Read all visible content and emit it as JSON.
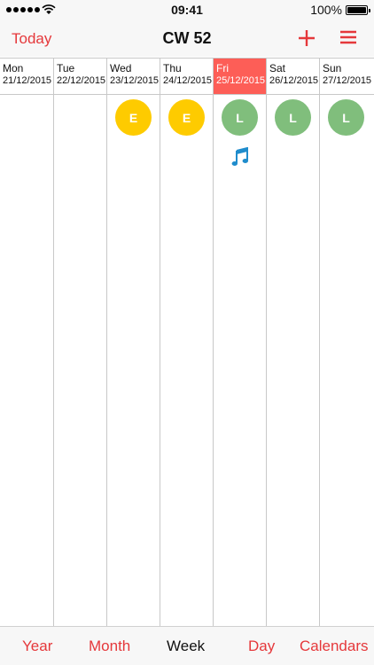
{
  "status_bar": {
    "time": "09:41",
    "battery": "100%"
  },
  "nav": {
    "today_label": "Today",
    "title": "CW 52"
  },
  "colors": {
    "accent": "#e5383b",
    "today_header": "#fd5e57",
    "shift_E": "#fecb00",
    "shift_L": "#80be7c",
    "music": "#1f8ccc"
  },
  "days": [
    {
      "name": "Mon",
      "date": "21/12/2015",
      "shift": ""
    },
    {
      "name": "Tue",
      "date": "22/12/2015",
      "shift": ""
    },
    {
      "name": "Wed",
      "date": "23/12/2015",
      "shift": "E"
    },
    {
      "name": "Thu",
      "date": "24/12/2015",
      "shift": "E"
    },
    {
      "name": "Fri",
      "date": "25/12/2015",
      "shift": "L",
      "today": true,
      "icon": "music-note-icon"
    },
    {
      "name": "Sat",
      "date": "26/12/2015",
      "shift": "L"
    },
    {
      "name": "Sun",
      "date": "27/12/2015",
      "shift": "L"
    }
  ],
  "tabs": [
    {
      "label": "Year",
      "active": false
    },
    {
      "label": "Month",
      "active": false
    },
    {
      "label": "Week",
      "active": true
    },
    {
      "label": "Day",
      "active": false
    },
    {
      "label": "Calendars",
      "active": false
    }
  ]
}
